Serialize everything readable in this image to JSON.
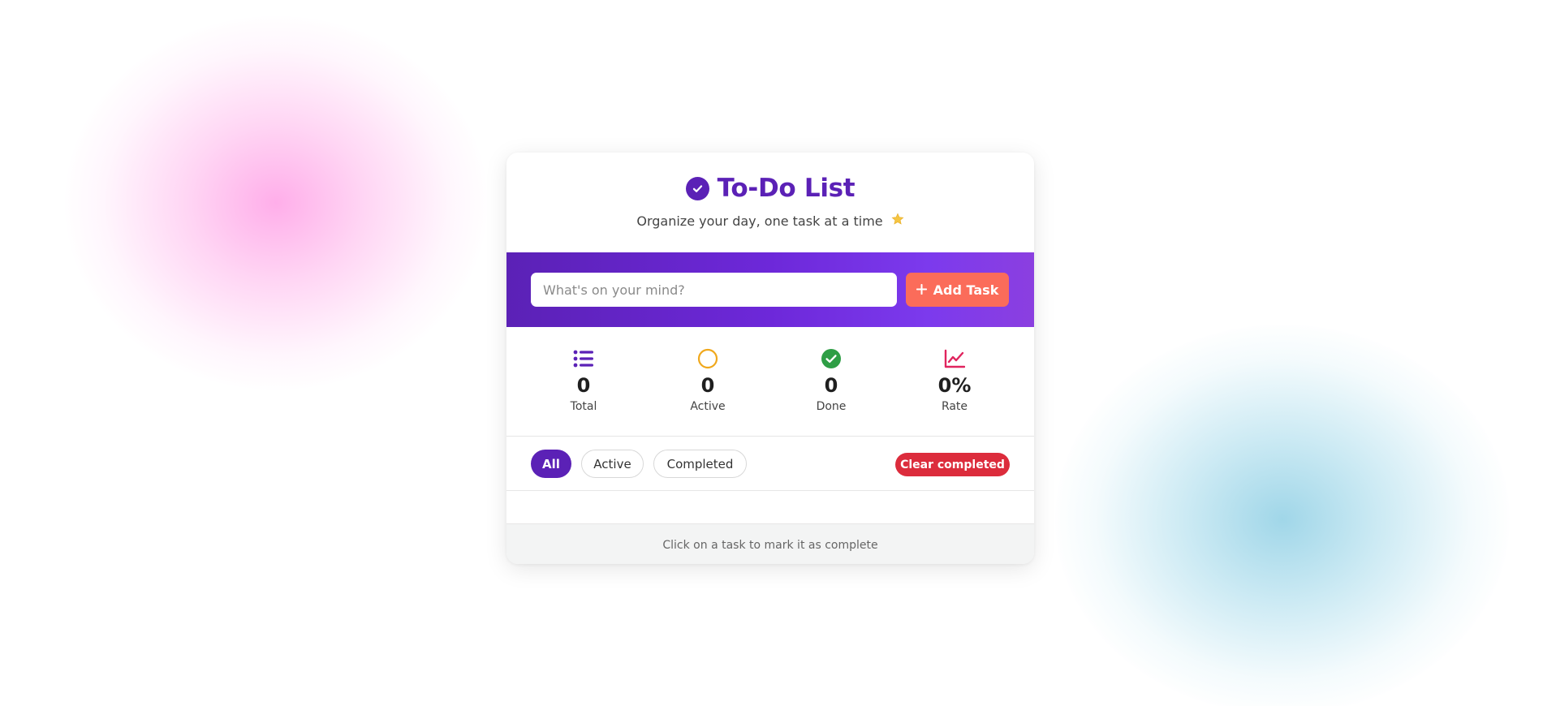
{
  "header": {
    "title": "To-Do List",
    "subtitle": "Organize your day, one task at a time",
    "subtitle_icon": "star-icon"
  },
  "add_task": {
    "placeholder": "What's on your mind?",
    "value": "",
    "button_label": "Add Task"
  },
  "stats": [
    {
      "value": "0",
      "label": "Total",
      "icon": "list-icon",
      "color": "#5b21b6"
    },
    {
      "value": "0",
      "label": "Active",
      "icon": "circle-outline-icon",
      "color": "#f0a81c"
    },
    {
      "value": "0",
      "label": "Done",
      "icon": "check-circle-icon",
      "color": "#2e9e45"
    },
    {
      "value": "0%",
      "label": "Rate",
      "icon": "line-chart-icon",
      "color": "#e0245e"
    }
  ],
  "filters": {
    "all_label": "All",
    "active_label": "Active",
    "completed_label": "Completed",
    "selected": "All",
    "clear_label": "Clear completed"
  },
  "tasks": [],
  "footer": {
    "hint": "Click on a task to mark it as complete"
  },
  "colors": {
    "primary": "#5b21b6",
    "accent_button": "#fb6c5a",
    "danger": "#dc2c3c",
    "star": "#f5c542"
  }
}
